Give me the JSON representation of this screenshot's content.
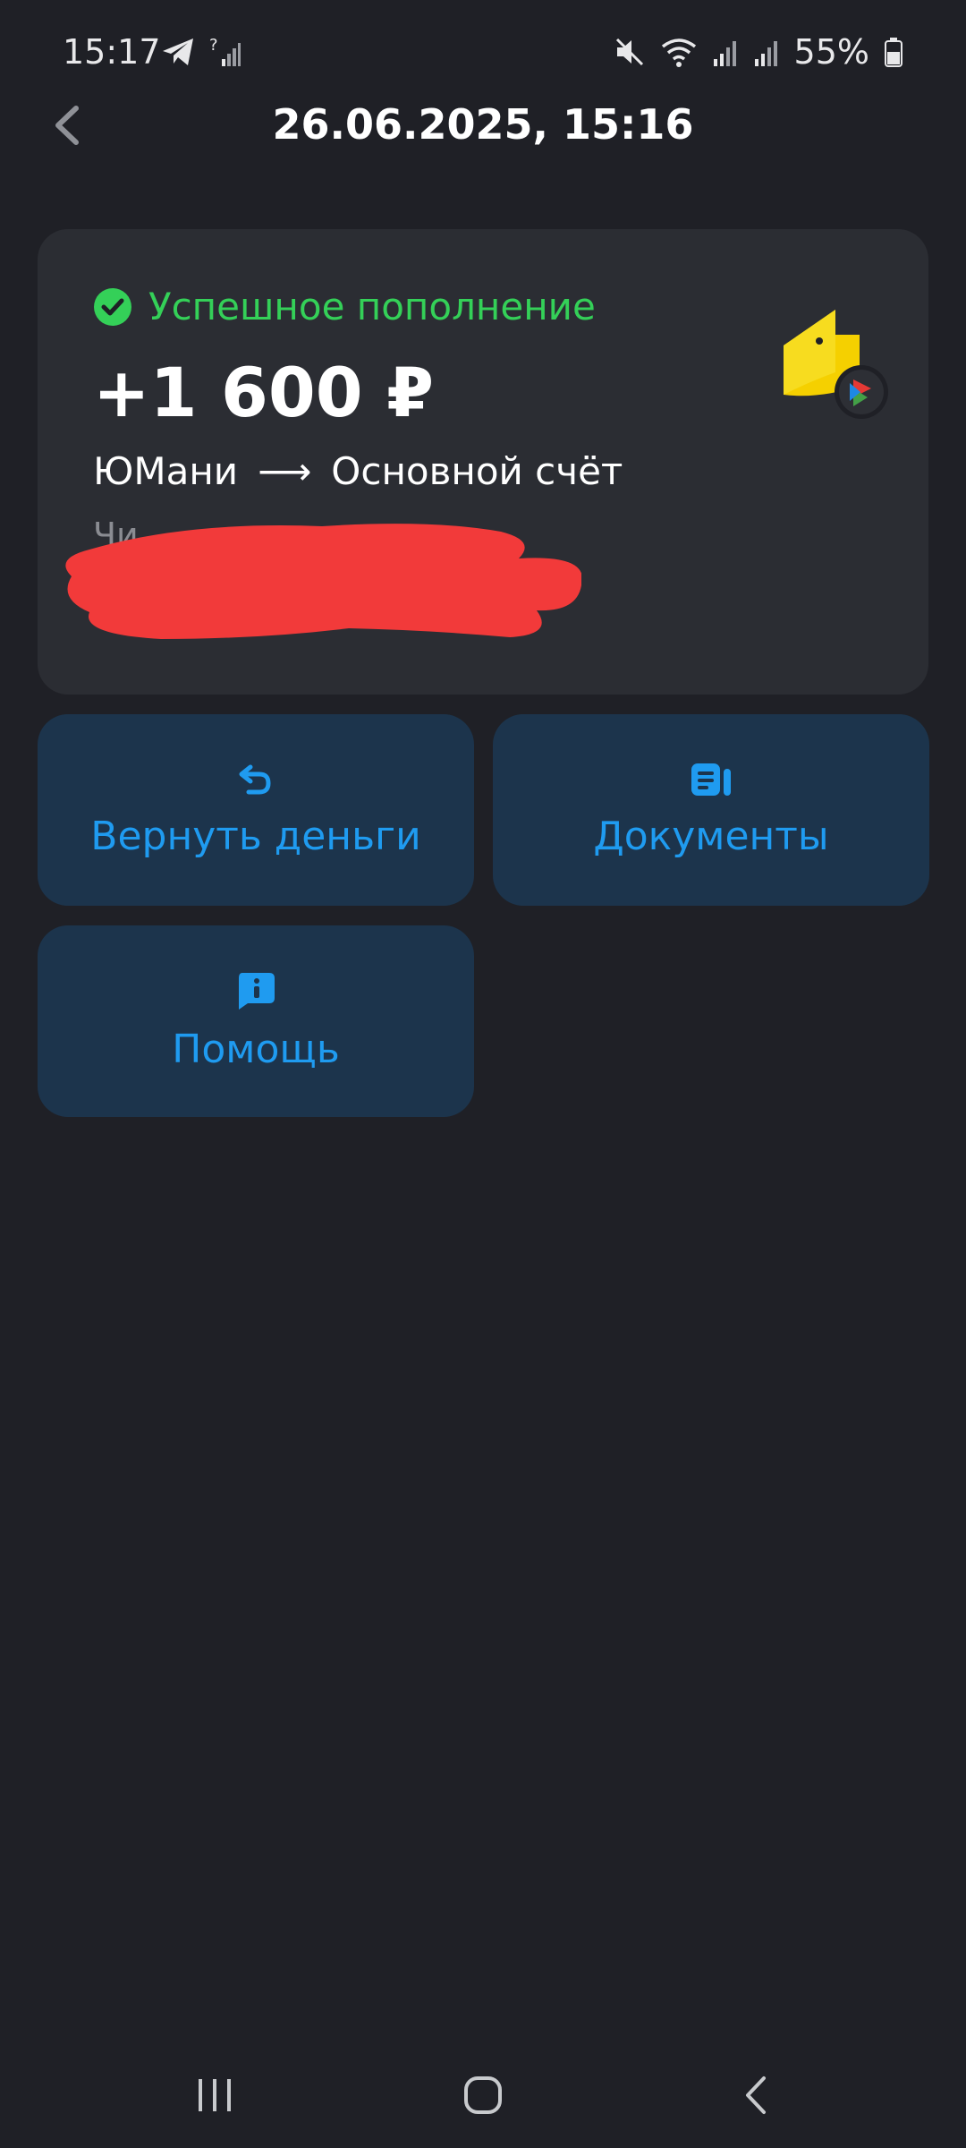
{
  "status_bar": {
    "time": "15:17",
    "battery": "55%"
  },
  "header": {
    "title": "26.06.2025, 15:16"
  },
  "transaction": {
    "status": "Успешное пополнение",
    "amount": "+1 600 ₽",
    "source": "ЮМани",
    "arrow": "⟶",
    "destination": "Основной счёт",
    "hidden_line": "Чи"
  },
  "actions": {
    "refund_label": "Вернуть деньги",
    "documents_label": "Документы",
    "help_label": "Помощь"
  },
  "colors": {
    "background": "#1f2026",
    "card": "#2b2d33",
    "tile": "#1c344c",
    "accent_blue": "#1f9bf0",
    "success_green": "#34d058",
    "redaction_red": "#f23a3a"
  },
  "icons": {
    "back": "chevron-left-icon",
    "status": "check-circle-icon",
    "refund": "undo-arrow-icon",
    "documents": "document-icon",
    "help": "info-bubble-icon",
    "merchant": "yoomoney-wallet-icon"
  }
}
